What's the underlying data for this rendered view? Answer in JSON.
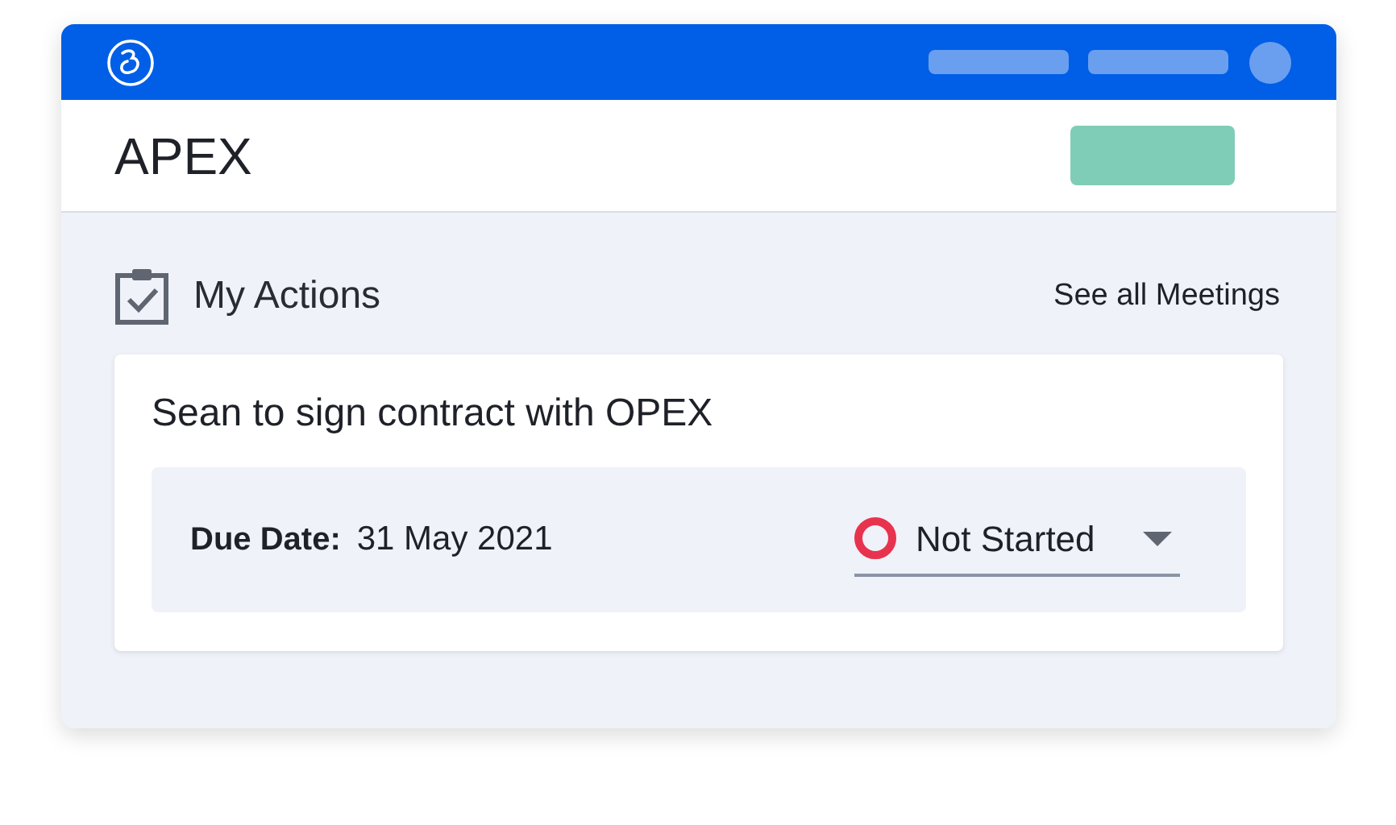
{
  "header": {
    "title": "APEX"
  },
  "section": {
    "title": "My Actions",
    "link": "See all Meetings"
  },
  "actions": [
    {
      "title": "Sean to sign contract with OPEX",
      "due_label": "Due Date:",
      "due_date": "31 May 2021",
      "status": {
        "kind": "not_started",
        "label": "Not Started"
      }
    }
  ]
}
